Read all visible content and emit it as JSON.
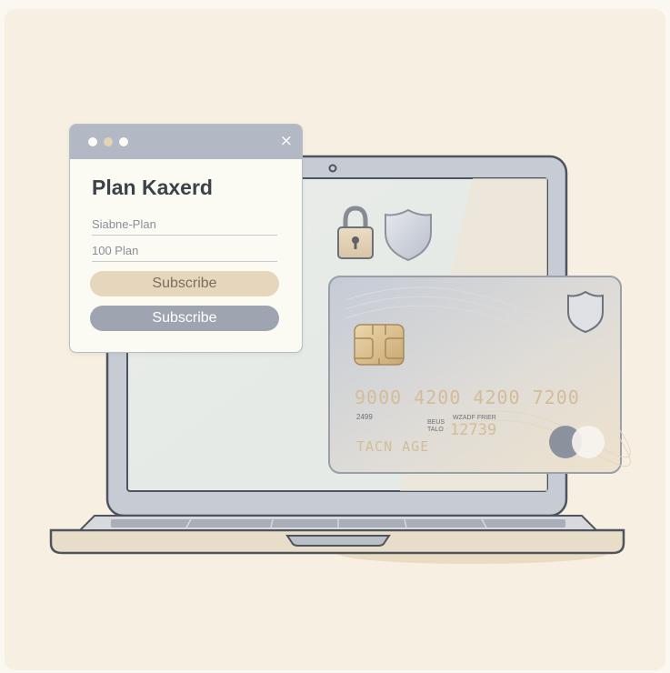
{
  "popup": {
    "title": "Plan Kaxerd",
    "close_glyph": "×",
    "fields": [
      "Siabne-Plan",
      "100 Plan"
    ],
    "buttons": [
      "Subscribe",
      "Subscribe"
    ],
    "icons": [
      "window-dot-icon",
      "window-dot-icon",
      "window-dot-icon",
      "close-icon"
    ]
  },
  "card": {
    "number": "9000 4200 4200 7200",
    "expiry": "2499",
    "label_left_1": "BEUS",
    "label_left_2": "TALO",
    "label_right": "WZADF FRIER",
    "code": "12739",
    "name": "TACN AGE",
    "icons": [
      "chip-icon",
      "shield-icon",
      "card-network-icon"
    ]
  },
  "scene_icons": [
    "laptop-icon",
    "padlock-icon",
    "shield-icon",
    "webcam-icon"
  ],
  "colors": {
    "background": "#f6efe2",
    "popup_bar": "#b2b8c4",
    "primary_button": "#e6d6bc",
    "secondary_button": "#9ea5b1",
    "card_gold": "#d2bd98"
  }
}
